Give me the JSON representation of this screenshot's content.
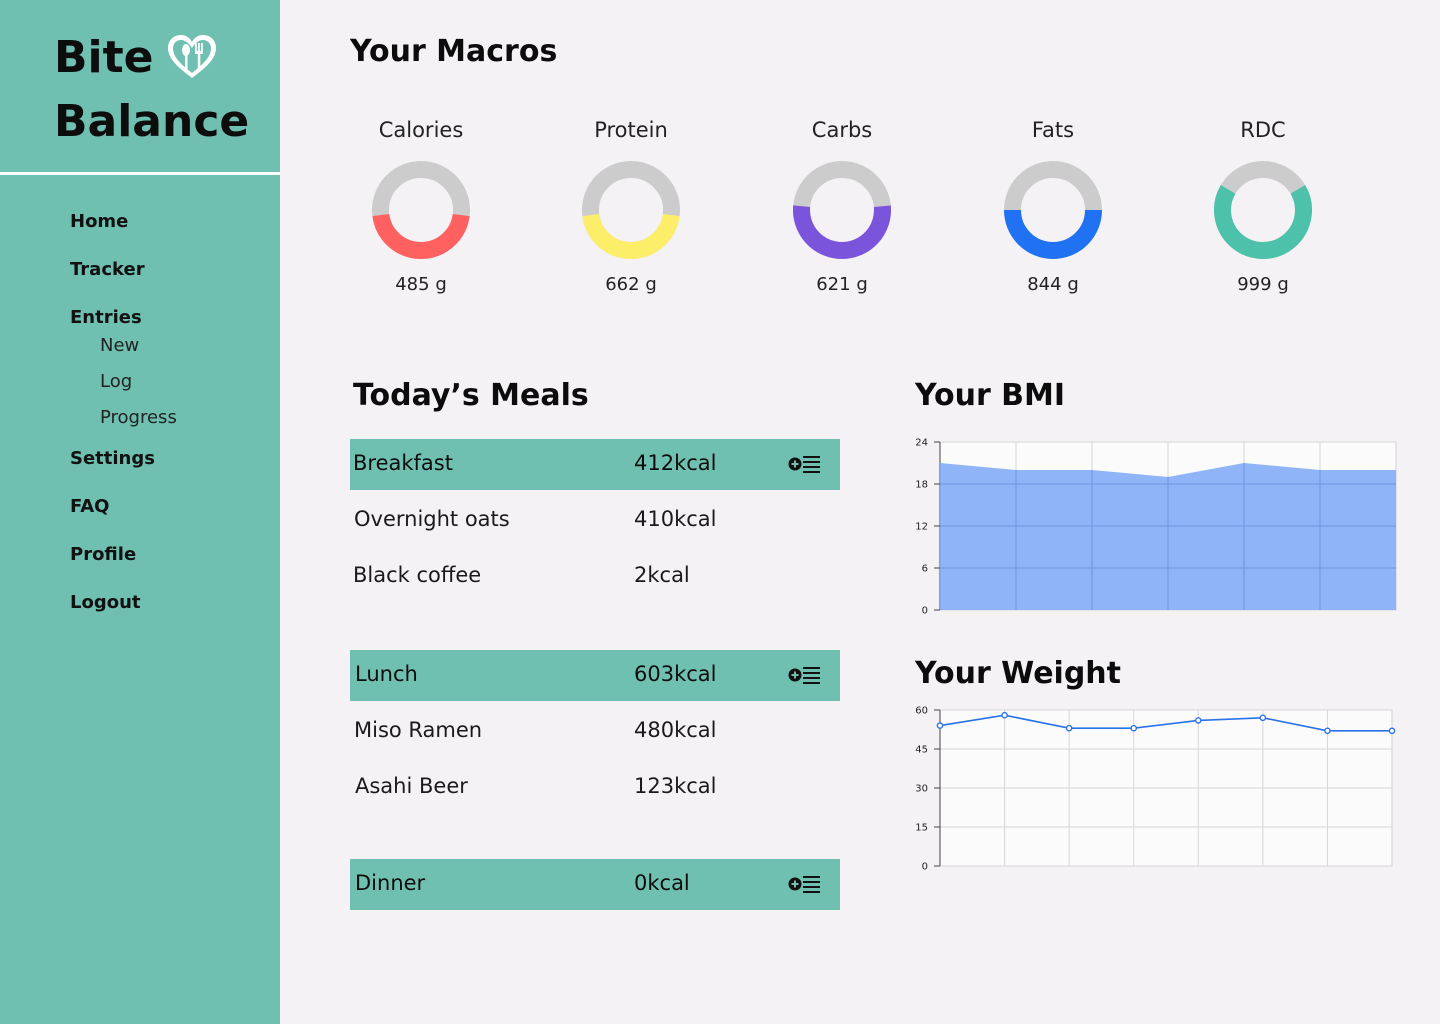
{
  "brand": {
    "line1": "Bite",
    "line2": "Balance"
  },
  "nav": {
    "home": "Home",
    "tracker": "Tracker",
    "entries": "Entries",
    "entries_sub": {
      "new": "New",
      "log": "Log",
      "progress": "Progress"
    },
    "settings": "Settings",
    "faq": "FAQ",
    "profile": "Profile",
    "logout": "Logout"
  },
  "macros": {
    "title": "Your Macros",
    "items": [
      {
        "label": "Calories",
        "value": "485 g",
        "fraction": 0.46,
        "color": "#ff6161"
      },
      {
        "label": "Protein",
        "value": "662 g",
        "fraction": 0.46,
        "color": "#fdee6a"
      },
      {
        "label": "Carbs",
        "value": "621 g",
        "fraction": 0.53,
        "color": "#7a55db"
      },
      {
        "label": "Fats",
        "value": "844 g",
        "fraction": 0.5,
        "color": "#2172f2"
      },
      {
        "label": "RDC",
        "value": "999 g",
        "fraction": 0.67,
        "color": "#4dc1aa"
      }
    ],
    "track_color": "#cccccc"
  },
  "meals": {
    "title": "Today’s Meals",
    "breakfast": {
      "name": "Breakfast",
      "kcal": "412kcal",
      "items": [
        {
          "name": "Overnight oats",
          "kcal": "410kcal"
        },
        {
          "name": "Black coffee",
          "kcal": "2kcal"
        }
      ]
    },
    "lunch": {
      "name": "Lunch",
      "kcal": "603kcal",
      "items": [
        {
          "name": "Miso Ramen",
          "kcal": "480kcal"
        },
        {
          "name": "Asahi Beer",
          "kcal": "123kcal"
        }
      ]
    },
    "dinner": {
      "name": "Dinner",
      "kcal": "0kcal",
      "items": []
    },
    "add_icon": "add-list-icon",
    "accent": "#6fc0b1"
  },
  "bmi": {
    "title": "Your BMI",
    "chart_data": {
      "type": "area",
      "x": [
        0,
        1,
        2,
        3,
        4,
        5,
        6
      ],
      "values": [
        21,
        20,
        20,
        19,
        21,
        20,
        20
      ],
      "ylim": [
        0,
        24
      ],
      "yticks": [
        0,
        6,
        12,
        18,
        24
      ],
      "grid": true,
      "color": "#86aef7"
    }
  },
  "weight": {
    "title": "Your Weight",
    "chart_data": {
      "type": "line",
      "x": [
        0,
        1,
        2,
        3,
        4,
        5,
        6,
        7
      ],
      "values": [
        54,
        58,
        53,
        53,
        56,
        57,
        52,
        52
      ],
      "ylim": [
        0,
        60
      ],
      "yticks": [
        0,
        15,
        30,
        45,
        60
      ],
      "grid": true,
      "color": "#2a72e8"
    }
  }
}
